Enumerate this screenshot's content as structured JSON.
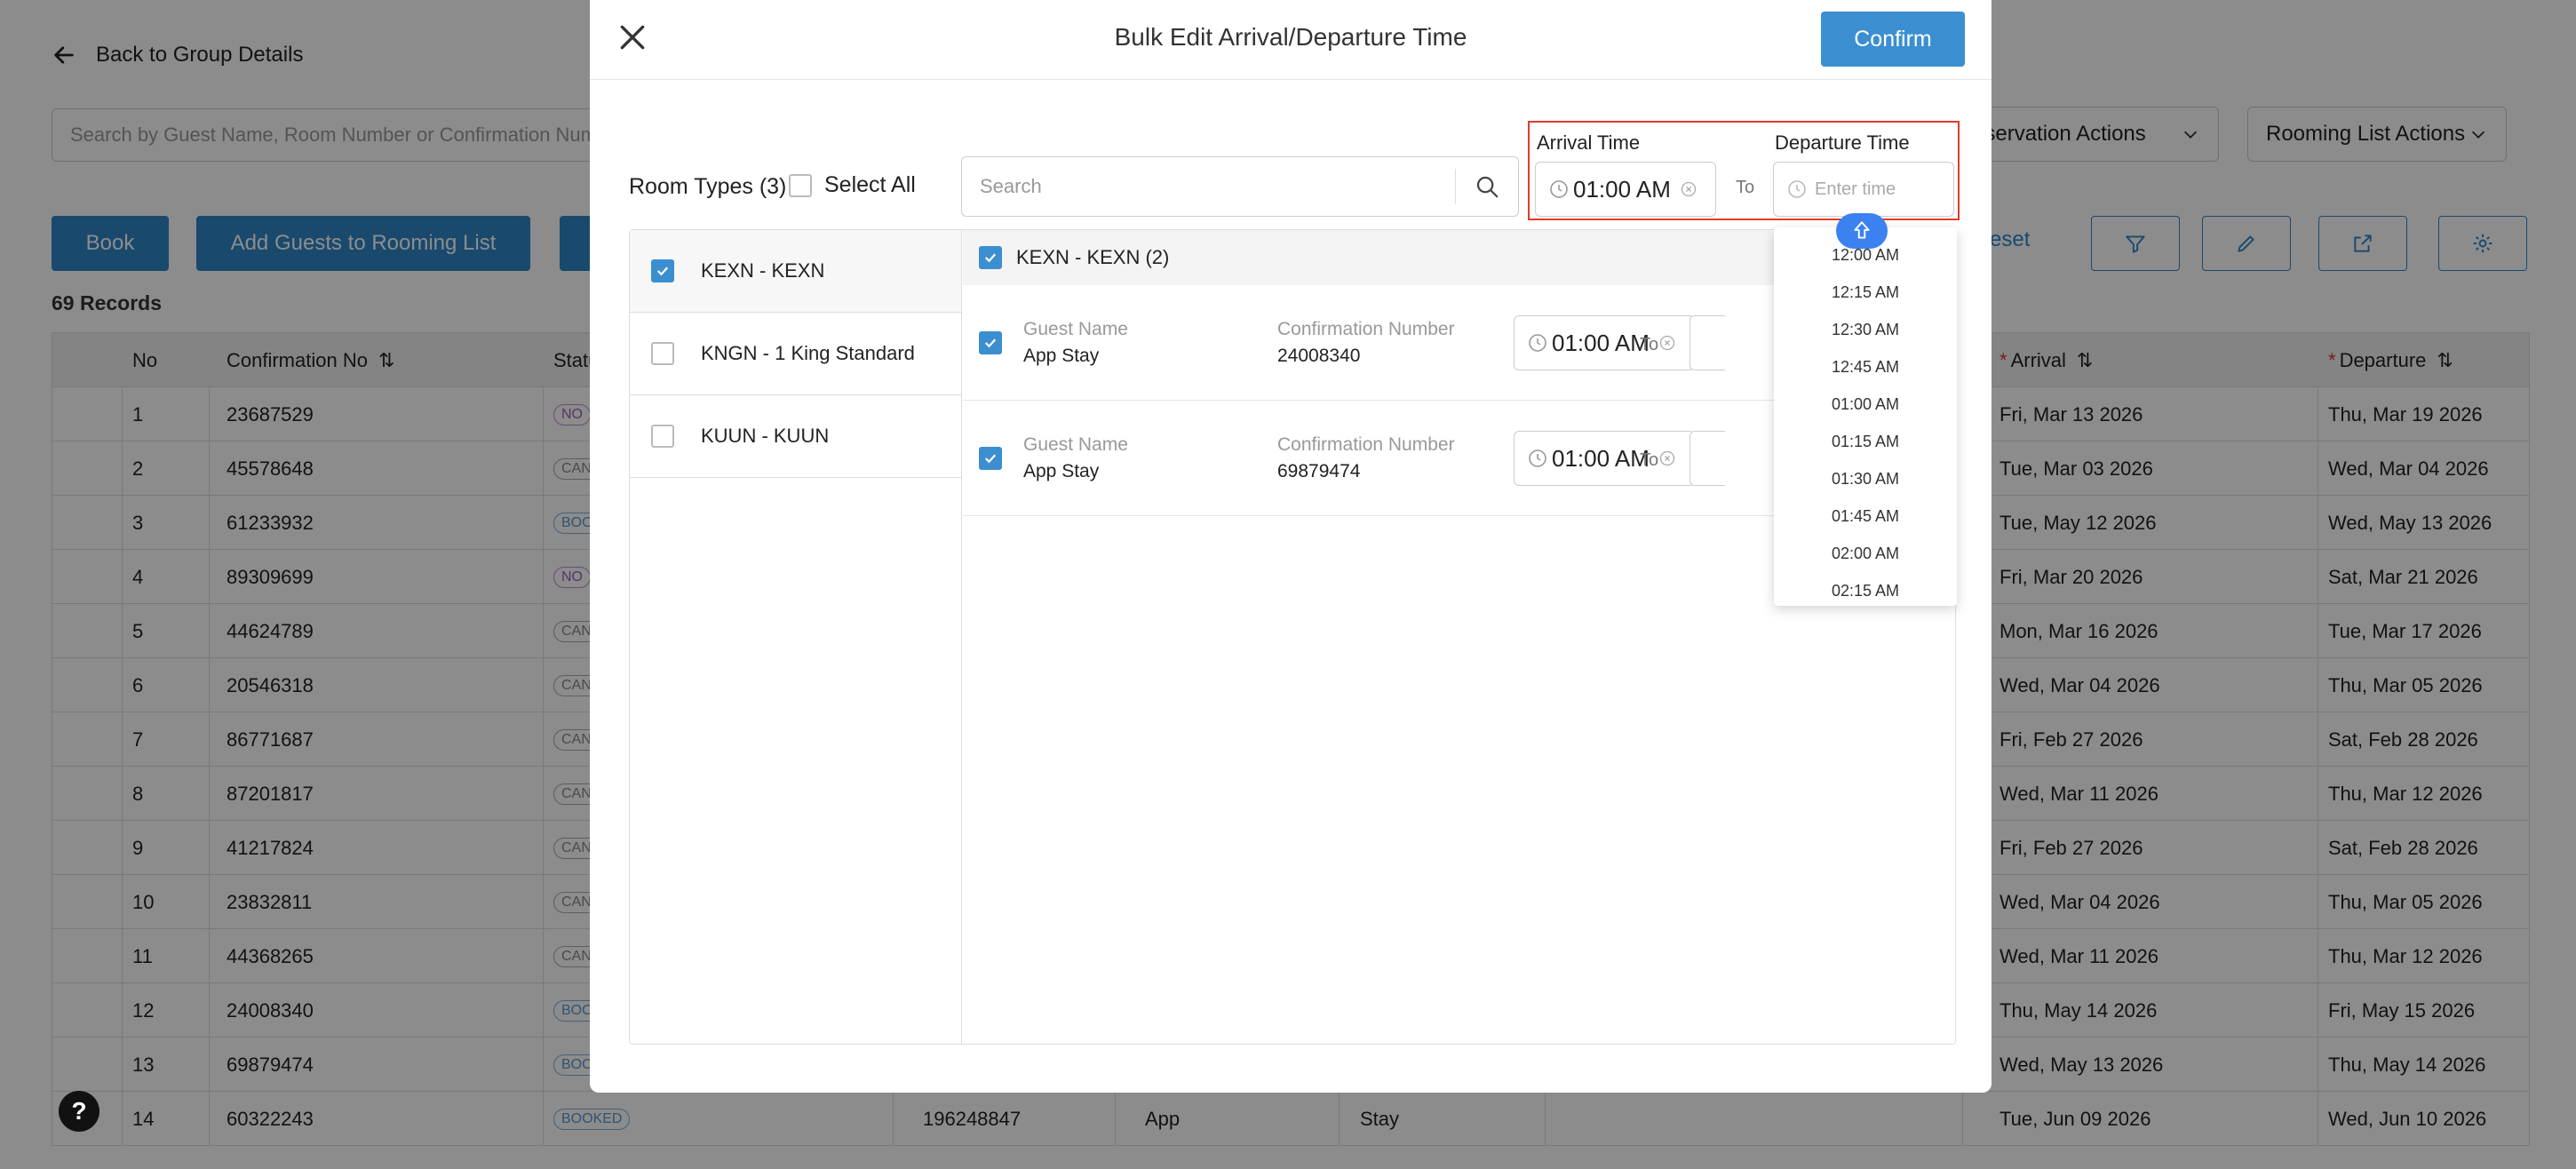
{
  "page": {
    "back_label": "Back to Group Details",
    "search_placeholder": "Search by Guest Name, Room Number or Confirmation Number",
    "reservation_actions": "eservation Actions",
    "rooming_list_actions": "Rooming List Actions",
    "book_label": "Book",
    "add_guests_label": "Add Guests to Rooming List",
    "reset_label": "eset",
    "records_label": "69 Records"
  },
  "table": {
    "headers": {
      "no": "No",
      "conf": "Confirmation No",
      "status": "Statu",
      "arrival": "Arrival",
      "departure": "Departure"
    },
    "rows": [
      {
        "no": "1",
        "conf": "23687529",
        "status": "NO",
        "status_kind": "noshow",
        "arrival": "Fri, Mar 13 2026",
        "departure": "Thu, Mar 19 2026"
      },
      {
        "no": "2",
        "conf": "45578648",
        "status": "CAN",
        "status_kind": "cancel",
        "arrival": "Tue, Mar 03 2026",
        "departure": "Wed, Mar 04 2026"
      },
      {
        "no": "3",
        "conf": "61233932",
        "status": "BOO",
        "status_kind": "booked",
        "arrival": "Tue, May 12 2026",
        "departure": "Wed, May 13 2026"
      },
      {
        "no": "4",
        "conf": "89309699",
        "status": "NO",
        "status_kind": "noshow",
        "arrival": "Fri, Mar 20 2026",
        "departure": "Sat, Mar 21 2026"
      },
      {
        "no": "5",
        "conf": "44624789",
        "status": "CAN",
        "status_kind": "cancel",
        "arrival": "Mon, Mar 16 2026",
        "departure": "Tue, Mar 17 2026"
      },
      {
        "no": "6",
        "conf": "20546318",
        "status": "CAN",
        "status_kind": "cancel",
        "arrival": "Wed, Mar 04 2026",
        "departure": "Thu, Mar 05 2026"
      },
      {
        "no": "7",
        "conf": "86771687",
        "status": "CAN",
        "status_kind": "cancel",
        "arrival": "Fri, Feb 27 2026",
        "departure": "Sat, Feb 28 2026"
      },
      {
        "no": "8",
        "conf": "87201817",
        "status": "CAN",
        "status_kind": "cancel",
        "arrival": "Wed, Mar 11 2026",
        "departure": "Thu, Mar 12 2026"
      },
      {
        "no": "9",
        "conf": "41217824",
        "status": "CAN",
        "status_kind": "cancel",
        "arrival": "Fri, Feb 27 2026",
        "departure": "Sat, Feb 28 2026"
      },
      {
        "no": "10",
        "conf": "23832811",
        "status": "CAN",
        "status_kind": "cancel",
        "arrival": "Wed, Mar 04 2026",
        "departure": "Thu, Mar 05 2026"
      },
      {
        "no": "11",
        "conf": "44368265",
        "status": "CAN",
        "status_kind": "cancel",
        "arrival": "Wed, Mar 11 2026",
        "departure": "Thu, Mar 12 2026"
      },
      {
        "no": "12",
        "conf": "24008340",
        "status": "BOO",
        "status_kind": "booked",
        "arrival": "Thu, May 14 2026",
        "departure": "Fri, May 15 2026"
      },
      {
        "no": "13",
        "conf": "69879474",
        "status": "BOO",
        "status_kind": "booked",
        "arrival": "Wed, May 13 2026",
        "departure": "Thu, May 14 2026"
      },
      {
        "no": "14",
        "conf": "60322243",
        "status": "BOOKED",
        "status_kind": "booked",
        "extra_no": "196248847",
        "first": "App",
        "last": "Stay",
        "arrival": "Tue, Jun 09 2026",
        "departure": "Wed, Jun 10 2026"
      }
    ]
  },
  "help_label": "?",
  "modal": {
    "title": "Bulk Edit Arrival/Departure Time",
    "confirm_label": "Confirm",
    "room_types_label": "Room Types (3)",
    "select_all_label": "Select All",
    "search_placeholder": "Search",
    "arrival_label": "Arrival Time",
    "departure_label": "Departure Time",
    "arrival_value": "01:00 AM",
    "departure_placeholder": "Enter time",
    "to_label": "To",
    "room_types": [
      {
        "label": "KEXN - KEXN",
        "checked": true
      },
      {
        "label": "KNGN - 1 King Standard",
        "checked": false
      },
      {
        "label": "KUUN - KUUN",
        "checked": false
      }
    ],
    "group_header": "KEXN - KEXN (2)",
    "guest_name_label": "Guest Name",
    "conf_number_label": "Confirmation Number",
    "guests": [
      {
        "name": "App Stay",
        "conf": "24008340",
        "time": "01:00 AM"
      },
      {
        "name": "App Stay",
        "conf": "69879474",
        "time": "01:00 AM"
      }
    ],
    "time_options": [
      "12:00 AM",
      "12:15 AM",
      "12:30 AM",
      "12:45 AM",
      "01:00 AM",
      "01:15 AM",
      "01:30 AM",
      "01:45 AM",
      "02:00 AM",
      "02:15 AM"
    ]
  },
  "colors": {
    "accent": "#3b8fd0",
    "highlight_border": "#e03c31",
    "overlay": "rgba(0,0,0,0.45)"
  }
}
